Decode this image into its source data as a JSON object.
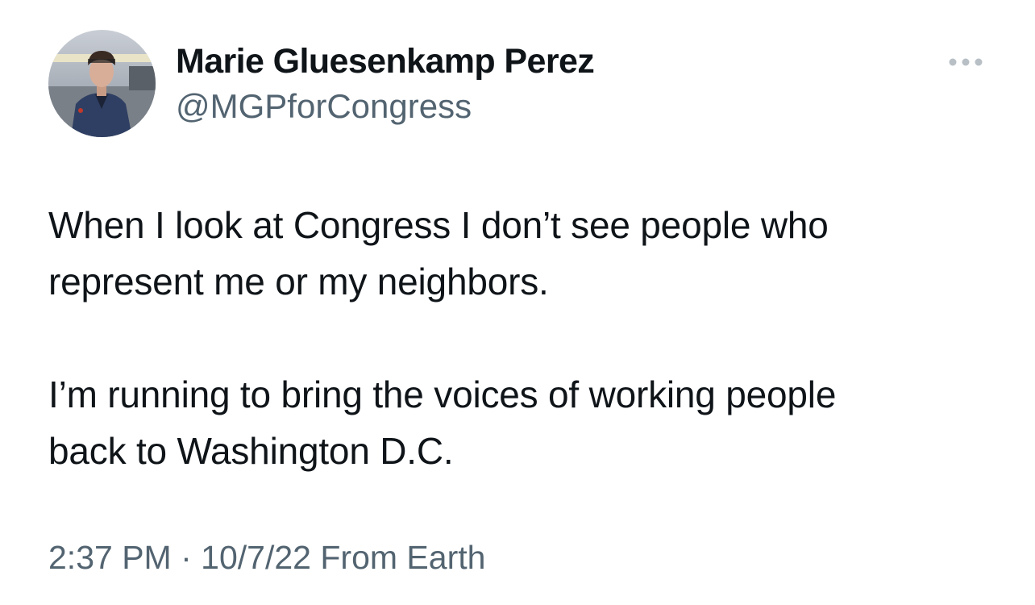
{
  "tweet": {
    "author": {
      "display_name": "Marie Gluesenkamp Perez",
      "handle": "@MGPforCongress",
      "avatar_icon": "profile-photo"
    },
    "menu_icon": "more-options-icon",
    "paragraphs": [
      {
        "lines": [
          "When I look at Congress I don’t see people who",
          "represent me or my neighbors."
        ]
      },
      {
        "lines": [
          "I’m running to bring the voices of working people",
          "back to Washington D.C."
        ]
      }
    ],
    "meta": {
      "time": "2:37 PM",
      "separator": "·",
      "date": "10/7/22",
      "source": "From Earth"
    },
    "colors": {
      "text": "#0f1419",
      "secondary_text": "#536471",
      "background": "#ffffff"
    }
  }
}
